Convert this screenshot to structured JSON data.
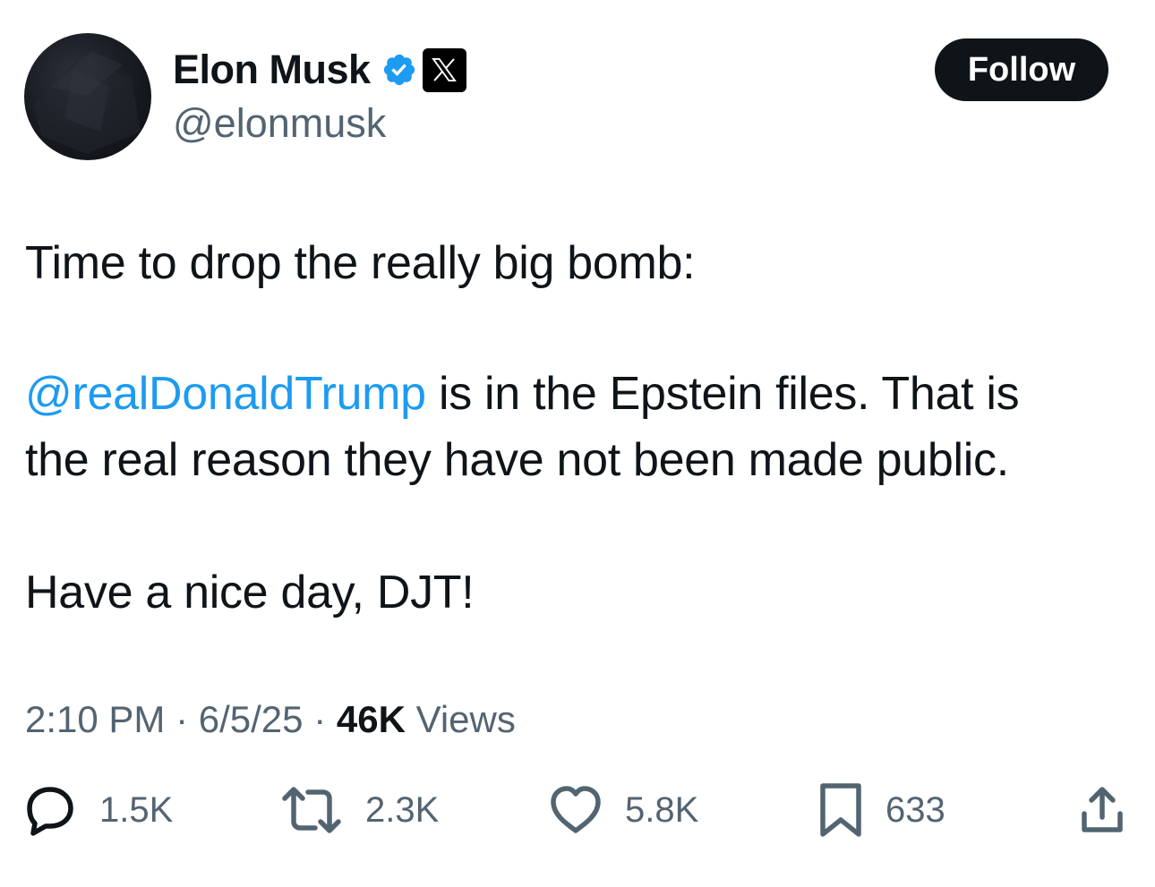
{
  "author": {
    "display_name": "Elon Musk",
    "handle": "@elonmusk",
    "verified_icon": "verified-badge-icon",
    "affiliation_icon": "x-logo-icon"
  },
  "follow_button": {
    "label": "Follow"
  },
  "tweet": {
    "line1": "Time to drop the really big bomb:",
    "mention": "@realDonaldTrump",
    "line2_rest": " is in the Epstein files. That is",
    "line3": "the real reason they have not been made public.",
    "line4": "Have a nice day, DJT!"
  },
  "meta": {
    "time": "2:10 PM",
    "separator": " · ",
    "date": "6/5/25",
    "views_count": "46K",
    "views_label": " Views"
  },
  "actions": {
    "replies": "1.5K",
    "reposts": "2.3K",
    "likes": "5.8K",
    "bookmarks": "633"
  },
  "colors": {
    "text": "#0f1419",
    "secondary": "#536471",
    "mention": "#1d9bf0",
    "verified": "#1d9bf0",
    "follow_bg": "#0f1419"
  }
}
